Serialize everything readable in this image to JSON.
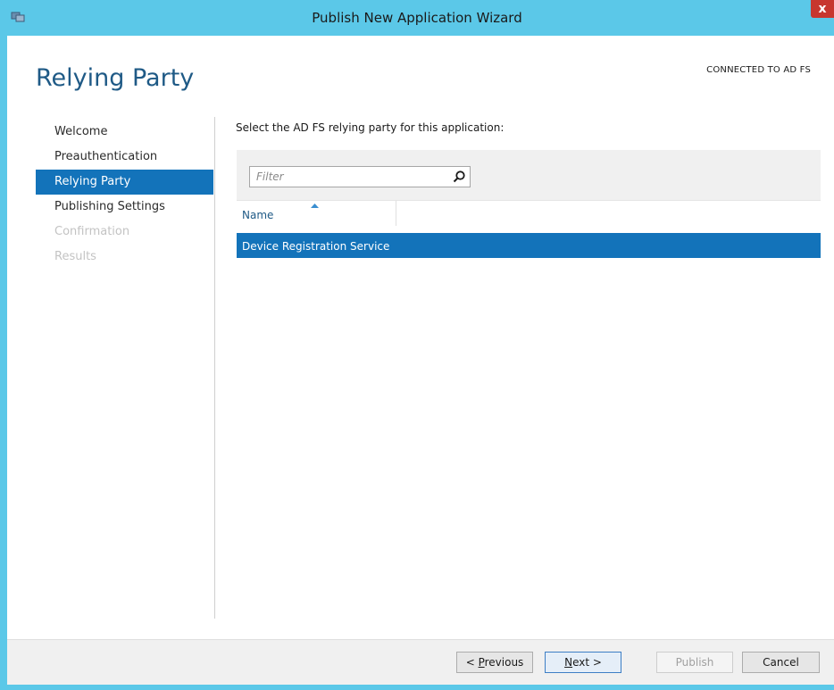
{
  "window": {
    "title": "Publish New Application Wizard",
    "close_glyph": "x"
  },
  "page": {
    "heading": "Relying Party",
    "connection_status": "CONNECTED TO AD FS"
  },
  "nav": {
    "items": [
      {
        "label": "Welcome",
        "state": "normal"
      },
      {
        "label": "Preauthentication",
        "state": "normal"
      },
      {
        "label": "Relying Party",
        "state": "selected"
      },
      {
        "label": "Publishing Settings",
        "state": "normal"
      },
      {
        "label": "Confirmation",
        "state": "disabled"
      },
      {
        "label": "Results",
        "state": "disabled"
      }
    ]
  },
  "main": {
    "prompt": "Select the AD FS relying party for this application:",
    "filter": {
      "placeholder": "Filter",
      "value": ""
    },
    "columns": [
      {
        "label": "Name",
        "sort": "ascending"
      }
    ],
    "rows": [
      {
        "name": "Device Registration Service",
        "selected": true
      }
    ]
  },
  "footer": {
    "previous": {
      "prefix": "< ",
      "mnemonic": "P",
      "rest": "revious"
    },
    "next": {
      "mnemonic": "N",
      "rest": "ext >"
    },
    "publish": "Publish",
    "cancel": "Cancel"
  },
  "colors": {
    "titlebar": "#5bc8e8",
    "accent": "#1373ba",
    "heading": "#1f5a86"
  }
}
